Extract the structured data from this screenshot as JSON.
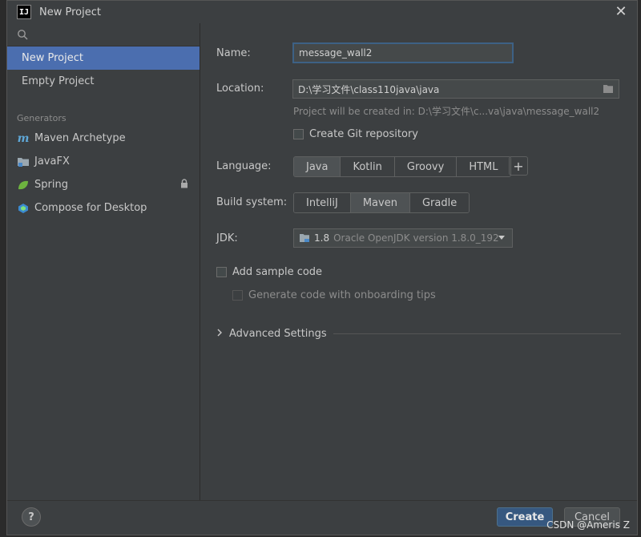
{
  "window": {
    "title": "New Project",
    "app_icon_text": "IJ"
  },
  "sidebar": {
    "items": [
      {
        "label": "New Project",
        "selected": true
      },
      {
        "label": "Empty Project",
        "selected": false
      }
    ],
    "generators_header": "Generators",
    "generators": [
      {
        "label": "Maven Archetype",
        "icon": "maven-icon"
      },
      {
        "label": "JavaFX",
        "icon": "folder-icon"
      },
      {
        "label": "Spring",
        "icon": "spring-leaf-icon",
        "locked": true
      },
      {
        "label": "Compose for Desktop",
        "icon": "compose-icon"
      }
    ]
  },
  "form": {
    "name_label": "Name:",
    "name_value": "message_wall2",
    "location_label": "Location:",
    "location_value": "D:\\学习文件\\class110java\\java",
    "location_hint": "Project will be created in: D:\\学习文件\\c...va\\java\\message_wall2",
    "git_label": "Create Git repository",
    "language_label": "Language:",
    "languages": [
      "Java",
      "Kotlin",
      "Groovy",
      "HTML"
    ],
    "language_selected": "Java",
    "build_label": "Build system:",
    "build_systems": [
      "IntelliJ",
      "Maven",
      "Gradle"
    ],
    "build_selected": "Maven",
    "jdk_label": "JDK:",
    "jdk_version": "1.8",
    "jdk_name": "Oracle OpenJDK version 1.8.0_192",
    "sample_code_label": "Add sample code",
    "onboarding_label": "Generate code with onboarding tips",
    "advanced_label": "Advanced Settings"
  },
  "footer": {
    "help_label": "?",
    "create_label": "Create",
    "cancel_label": "Cancel"
  },
  "watermark": "CSDN @Ameris Z",
  "colors": {
    "accent": "#4b6eaf",
    "primary_button": "#365880",
    "background": "#3c3f41"
  }
}
